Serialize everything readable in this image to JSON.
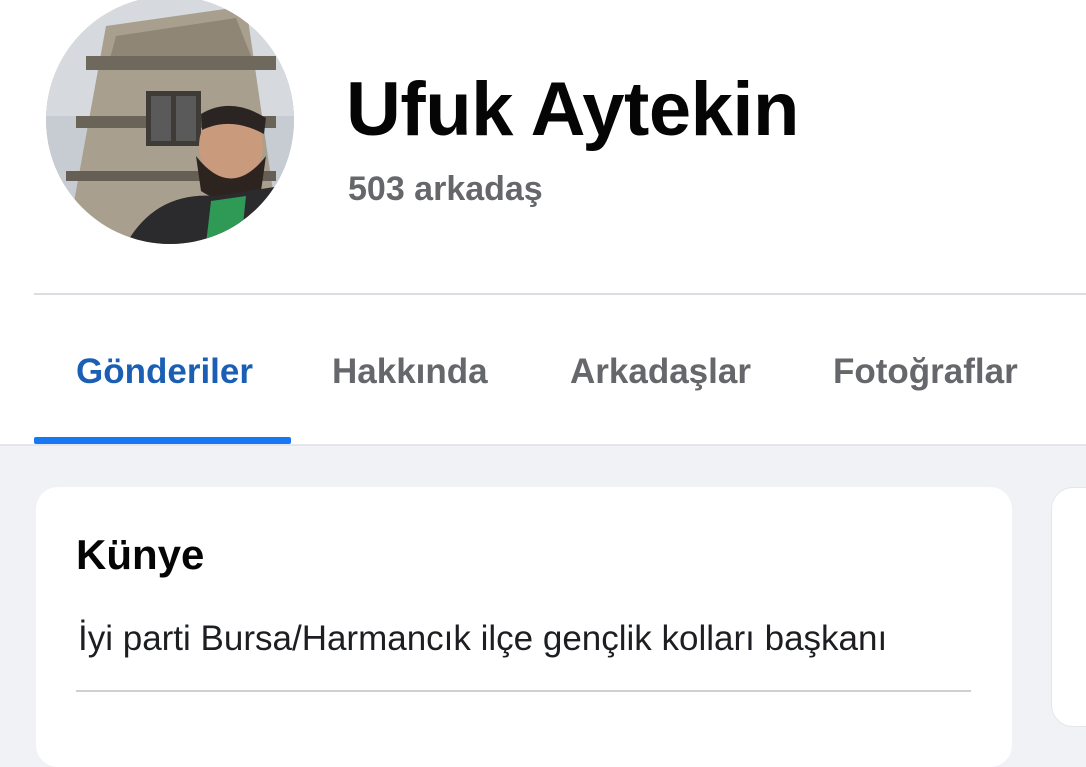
{
  "profile": {
    "name": "Ufuk Aytekin",
    "friends": "503 arkadaş"
  },
  "tabs": [
    {
      "label": "Gönderiler",
      "active": true
    },
    {
      "label": "Hakkında",
      "active": false
    },
    {
      "label": "Arkadaşlar",
      "active": false
    },
    {
      "label": "Fotoğraflar",
      "active": false
    }
  ],
  "intro_card": {
    "title": "Künye",
    "bio": "İyi parti Bursa/Harmancık ilçe gençlik kolları başkanı"
  },
  "colors": {
    "accent": "#1877f2",
    "active_tab_text": "#1a5fb4",
    "secondary_text": "#65676b",
    "page_background": "#f0f2f5"
  }
}
